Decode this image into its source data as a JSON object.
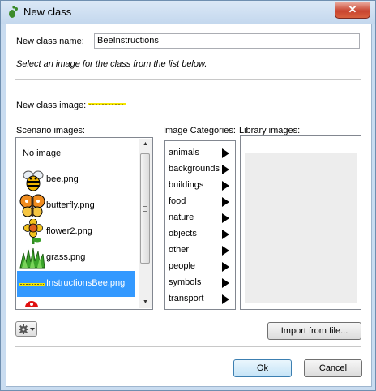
{
  "window": {
    "title": "New class",
    "close_glyph": "✕"
  },
  "form": {
    "name_label": "New class name:",
    "name_value": "BeeInstructions",
    "hint": "Select an image for the class from the list below.",
    "image_label": "New class image:"
  },
  "scenario": {
    "label": "Scenario images:",
    "items": [
      {
        "label": "No image",
        "icon": "none"
      },
      {
        "label": "bee.png",
        "icon": "bee-icon"
      },
      {
        "label": "butterfly.png",
        "icon": "butterfly-icon"
      },
      {
        "label": "flower2.png",
        "icon": "flower-icon"
      },
      {
        "label": "grass.png",
        "icon": "grass-icon"
      },
      {
        "label": "InstructionsBee.png",
        "icon": "instructions-bee-icon",
        "selected": true
      }
    ]
  },
  "categories": {
    "label": "Image Categories:",
    "items": [
      "animals",
      "backgrounds",
      "buildings",
      "food",
      "nature",
      "objects",
      "other",
      "people",
      "symbols",
      "transport"
    ]
  },
  "library": {
    "label": "Library images:"
  },
  "buttons": {
    "import": "Import from file...",
    "ok": "Ok",
    "cancel": "Cancel"
  },
  "colors": {
    "selection": "#3399ff",
    "titlebar": "#c4d8ee",
    "close": "#c8442f"
  }
}
